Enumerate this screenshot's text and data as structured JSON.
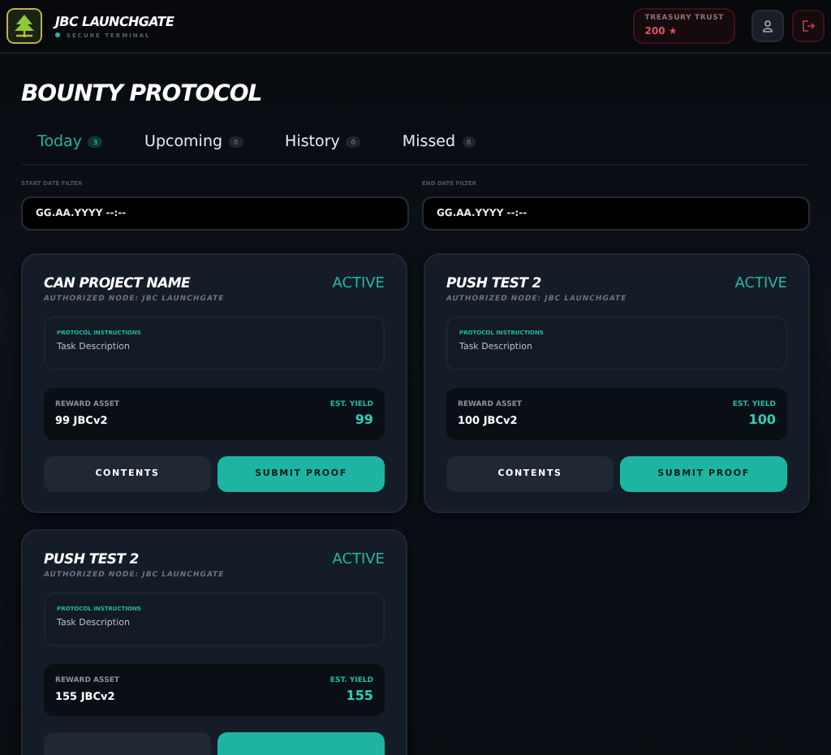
{
  "header": {
    "brand": "JBC LAUNCHGATE",
    "subtitle": "SECURE TERMINAL",
    "treasury": {
      "label": "TREASURY TRUST",
      "value": "200",
      "star": "★"
    }
  },
  "page_title": "BOUNTY PROTOCOL",
  "tabs": [
    {
      "label": "Today",
      "count": "3",
      "selected": true
    },
    {
      "label": "Upcoming",
      "count": "0",
      "selected": false
    },
    {
      "label": "History",
      "count": "0",
      "selected": false
    },
    {
      "label": "Missed",
      "count": "0",
      "selected": false
    }
  ],
  "filters": [
    {
      "label": "START DATE FILTER",
      "placeholder": "GG.AA.YYYY --:--"
    },
    {
      "label": "END DATE FILTER",
      "placeholder": "GG.AA.YYYY --:--"
    }
  ],
  "cards": [
    {
      "title": "CAN PROJECT NAME",
      "status": "ACTIVE",
      "node": "AUTHORIZED NODE: JBC LAUNCHGATE",
      "instructions_label": "PROTOCOL INSTRUCTIONS",
      "instructions": "Task Description",
      "reward_label": "REWARD ASSET",
      "reward": "99 JBCv2",
      "yield_label": "EST. YIELD",
      "yield": "99",
      "contents_button": "CONTENTS",
      "submit_button": "SUBMIT PROOF"
    },
    {
      "title": "PUSH TEST 2",
      "status": "ACTIVE",
      "node": "AUTHORIZED NODE: JBC LAUNCHGATE",
      "instructions_label": "PROTOCOL INSTRUCTIONS",
      "instructions": "Task Description",
      "reward_label": "REWARD ASSET",
      "reward": "100 JBCv2",
      "yield_label": "EST. YIELD",
      "yield": "100",
      "contents_button": "CONTENTS",
      "submit_button": "SUBMIT PROOF"
    },
    {
      "title": "PUSH TEST 2",
      "status": "ACTIVE",
      "node": "AUTHORIZED NODE: JBC LAUNCHGATE",
      "instructions_label": "PROTOCOL INSTRUCTIONS",
      "instructions": "Task Description",
      "reward_label": "REWARD ASSET",
      "reward": "155 JBCv2",
      "yield_label": "EST. YIELD",
      "yield": "155"
    }
  ]
}
